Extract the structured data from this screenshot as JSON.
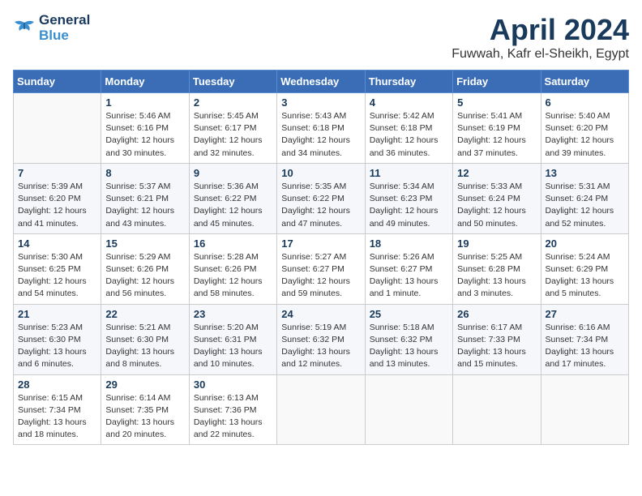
{
  "header": {
    "logo_line1": "General",
    "logo_line2": "Blue",
    "title": "April 2024",
    "subtitle": "Fuwwah, Kafr el-Sheikh, Egypt"
  },
  "calendar": {
    "columns": [
      "Sunday",
      "Monday",
      "Tuesday",
      "Wednesday",
      "Thursday",
      "Friday",
      "Saturday"
    ],
    "weeks": [
      [
        {
          "day": "",
          "info": ""
        },
        {
          "day": "1",
          "info": "Sunrise: 5:46 AM\nSunset: 6:16 PM\nDaylight: 12 hours\nand 30 minutes."
        },
        {
          "day": "2",
          "info": "Sunrise: 5:45 AM\nSunset: 6:17 PM\nDaylight: 12 hours\nand 32 minutes."
        },
        {
          "day": "3",
          "info": "Sunrise: 5:43 AM\nSunset: 6:18 PM\nDaylight: 12 hours\nand 34 minutes."
        },
        {
          "day": "4",
          "info": "Sunrise: 5:42 AM\nSunset: 6:18 PM\nDaylight: 12 hours\nand 36 minutes."
        },
        {
          "day": "5",
          "info": "Sunrise: 5:41 AM\nSunset: 6:19 PM\nDaylight: 12 hours\nand 37 minutes."
        },
        {
          "day": "6",
          "info": "Sunrise: 5:40 AM\nSunset: 6:20 PM\nDaylight: 12 hours\nand 39 minutes."
        }
      ],
      [
        {
          "day": "7",
          "info": "Sunrise: 5:39 AM\nSunset: 6:20 PM\nDaylight: 12 hours\nand 41 minutes."
        },
        {
          "day": "8",
          "info": "Sunrise: 5:37 AM\nSunset: 6:21 PM\nDaylight: 12 hours\nand 43 minutes."
        },
        {
          "day": "9",
          "info": "Sunrise: 5:36 AM\nSunset: 6:22 PM\nDaylight: 12 hours\nand 45 minutes."
        },
        {
          "day": "10",
          "info": "Sunrise: 5:35 AM\nSunset: 6:22 PM\nDaylight: 12 hours\nand 47 minutes."
        },
        {
          "day": "11",
          "info": "Sunrise: 5:34 AM\nSunset: 6:23 PM\nDaylight: 12 hours\nand 49 minutes."
        },
        {
          "day": "12",
          "info": "Sunrise: 5:33 AM\nSunset: 6:24 PM\nDaylight: 12 hours\nand 50 minutes."
        },
        {
          "day": "13",
          "info": "Sunrise: 5:31 AM\nSunset: 6:24 PM\nDaylight: 12 hours\nand 52 minutes."
        }
      ],
      [
        {
          "day": "14",
          "info": "Sunrise: 5:30 AM\nSunset: 6:25 PM\nDaylight: 12 hours\nand 54 minutes."
        },
        {
          "day": "15",
          "info": "Sunrise: 5:29 AM\nSunset: 6:26 PM\nDaylight: 12 hours\nand 56 minutes."
        },
        {
          "day": "16",
          "info": "Sunrise: 5:28 AM\nSunset: 6:26 PM\nDaylight: 12 hours\nand 58 minutes."
        },
        {
          "day": "17",
          "info": "Sunrise: 5:27 AM\nSunset: 6:27 PM\nDaylight: 12 hours\nand 59 minutes."
        },
        {
          "day": "18",
          "info": "Sunrise: 5:26 AM\nSunset: 6:27 PM\nDaylight: 13 hours\nand 1 minute."
        },
        {
          "day": "19",
          "info": "Sunrise: 5:25 AM\nSunset: 6:28 PM\nDaylight: 13 hours\nand 3 minutes."
        },
        {
          "day": "20",
          "info": "Sunrise: 5:24 AM\nSunset: 6:29 PM\nDaylight: 13 hours\nand 5 minutes."
        }
      ],
      [
        {
          "day": "21",
          "info": "Sunrise: 5:23 AM\nSunset: 6:30 PM\nDaylight: 13 hours\nand 6 minutes."
        },
        {
          "day": "22",
          "info": "Sunrise: 5:21 AM\nSunset: 6:30 PM\nDaylight: 13 hours\nand 8 minutes."
        },
        {
          "day": "23",
          "info": "Sunrise: 5:20 AM\nSunset: 6:31 PM\nDaylight: 13 hours\nand 10 minutes."
        },
        {
          "day": "24",
          "info": "Sunrise: 5:19 AM\nSunset: 6:32 PM\nDaylight: 13 hours\nand 12 minutes."
        },
        {
          "day": "25",
          "info": "Sunrise: 5:18 AM\nSunset: 6:32 PM\nDaylight: 13 hours\nand 13 minutes."
        },
        {
          "day": "26",
          "info": "Sunrise: 6:17 AM\nSunset: 7:33 PM\nDaylight: 13 hours\nand 15 minutes."
        },
        {
          "day": "27",
          "info": "Sunrise: 6:16 AM\nSunset: 7:34 PM\nDaylight: 13 hours\nand 17 minutes."
        }
      ],
      [
        {
          "day": "28",
          "info": "Sunrise: 6:15 AM\nSunset: 7:34 PM\nDaylight: 13 hours\nand 18 minutes."
        },
        {
          "day": "29",
          "info": "Sunrise: 6:14 AM\nSunset: 7:35 PM\nDaylight: 13 hours\nand 20 minutes."
        },
        {
          "day": "30",
          "info": "Sunrise: 6:13 AM\nSunset: 7:36 PM\nDaylight: 13 hours\nand 22 minutes."
        },
        {
          "day": "",
          "info": ""
        },
        {
          "day": "",
          "info": ""
        },
        {
          "day": "",
          "info": ""
        },
        {
          "day": "",
          "info": ""
        }
      ]
    ]
  }
}
